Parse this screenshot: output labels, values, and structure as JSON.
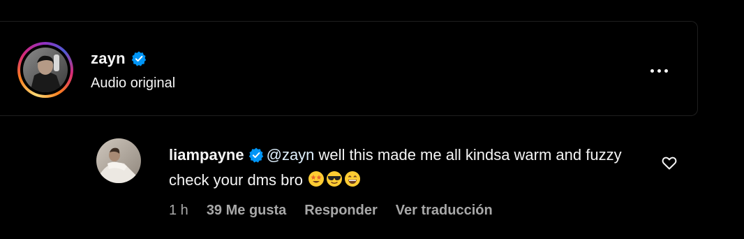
{
  "header": {
    "username": "zayn",
    "subtitle": "Audio original",
    "verified": true
  },
  "comment": {
    "username": "liampayne",
    "verified": true,
    "mention": "@zayn",
    "text": " well this made me all kindsa warm and fuzzy check your dms bro ",
    "emojis": [
      "star-struck-emoji",
      "sunglasses-emoji",
      "grinning-emoji"
    ],
    "time": "1 h",
    "likes": "39 Me gusta",
    "reply_label": "Responder",
    "translate_label": "Ver traducción"
  },
  "colors": {
    "background": "#000000",
    "text": "#f5f5f5",
    "muted": "#a8a8a8",
    "verified_blue": "#0095f6"
  }
}
